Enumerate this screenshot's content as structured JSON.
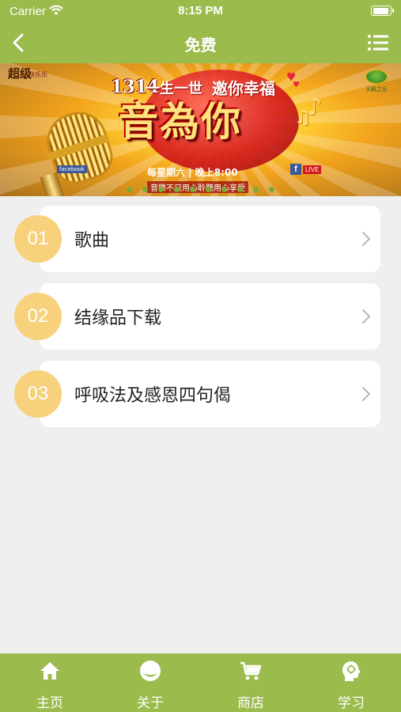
{
  "status_bar": {
    "carrier": "Carrier",
    "time": "8:15 PM"
  },
  "nav": {
    "title": "免费",
    "back_icon": "chevron-left-icon",
    "menu_icon": "list-icon"
  },
  "banner": {
    "brand": "超级",
    "brand_sub": "快乐乐",
    "channel": "天籁之乐",
    "number": "1314",
    "slogan_left": "一生一世",
    "slogan_right": "邀你幸福",
    "title": "音為你",
    "schedule": "每星期六 | 晚上8:00",
    "tagline": "音樂不只用心聆聽用心享受",
    "facebook_left": "facebook",
    "live": "LIVE",
    "page_count": 10
  },
  "menu": {
    "items": [
      {
        "number": "01",
        "label": "歌曲"
      },
      {
        "number": "02",
        "label": "结缘品下载"
      },
      {
        "number": "03",
        "label": "呼吸法及感恩四句偈"
      }
    ]
  },
  "tabs": [
    {
      "label": "主页",
      "icon": "home-icon"
    },
    {
      "label": "关于",
      "icon": "about-icon"
    },
    {
      "label": "商店",
      "icon": "cart-icon"
    },
    {
      "label": "学习",
      "icon": "head-icon"
    }
  ],
  "colors": {
    "accent": "#9cbb4d",
    "badge": "#f7d17b",
    "background": "#efefef"
  }
}
